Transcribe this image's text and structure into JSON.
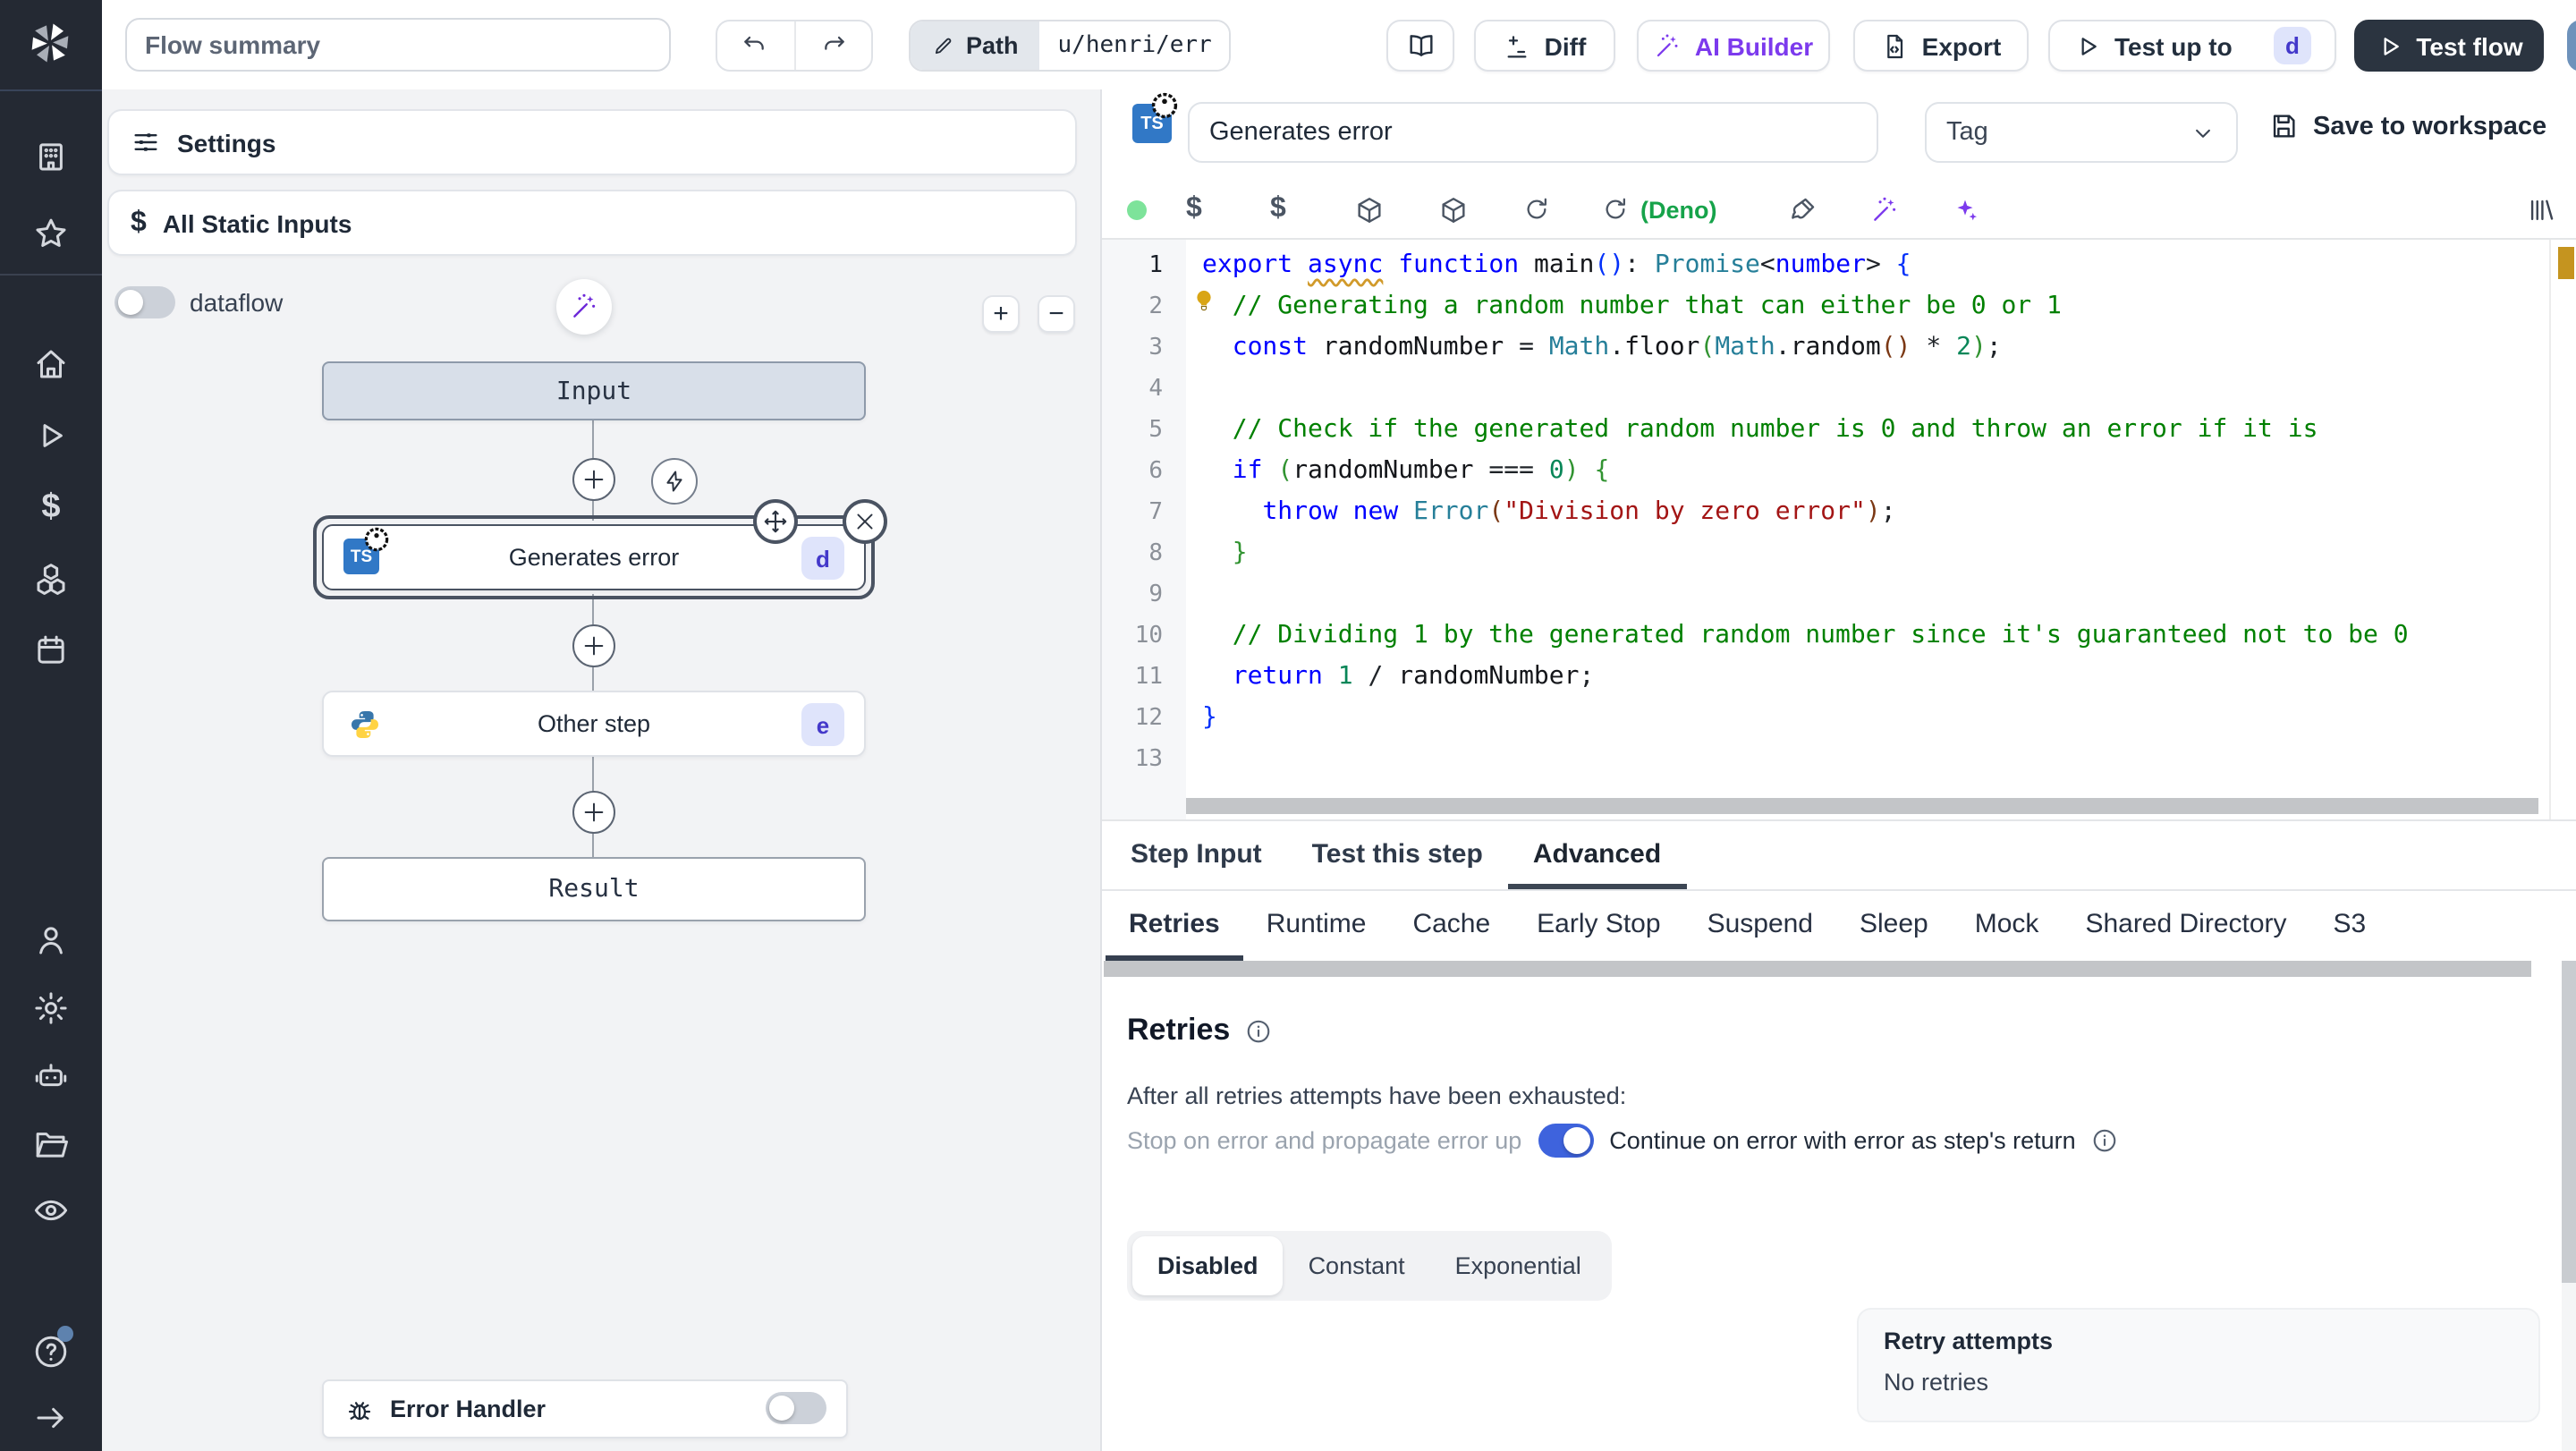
{
  "colors": {
    "accent_blue": "#3e63dd",
    "purple": "#7c3aed",
    "deno_green": "#16a34a",
    "badge_bg": "#dfe4fb",
    "badge_text": "#4338ca",
    "dark_button": "#2b3440",
    "warning_marker": "#c5941f",
    "sidebar_bg": "#242933"
  },
  "topbar": {
    "flow_summary": "Flow summary",
    "path_label": "Path",
    "path_value": "u/henri/err",
    "diff": "Diff",
    "ai_builder": "AI Builder",
    "export": "Export",
    "test_up_to": "Test up to",
    "test_up_to_badge": "d",
    "test_flow": "Test flow"
  },
  "graph": {
    "settings": "Settings",
    "all_static_inputs": "All Static Inputs",
    "dataflow": "dataflow",
    "zoom_in": "+",
    "zoom_out": "−",
    "input_node": "Input",
    "result_node": "Result",
    "error_handler": "Error Handler",
    "steps": [
      {
        "title": "Generates error",
        "badge": "d",
        "language": "typescript",
        "icon_label": "TS"
      },
      {
        "title": "Other step",
        "badge": "e",
        "language": "python"
      }
    ]
  },
  "step_editor": {
    "name": "Generates error",
    "icon_label": "TS",
    "tag_placeholder": "Tag",
    "save": "Save to workspace",
    "runtime": "(Deno)"
  },
  "code": {
    "bulb_line": 2,
    "lines": [
      [
        [
          "kw",
          "export"
        ],
        [
          "pl",
          " "
        ],
        [
          "kw sq",
          "async"
        ],
        [
          "pl",
          " "
        ],
        [
          "kw",
          "function"
        ],
        [
          "pl",
          " "
        ],
        [
          "id",
          "main"
        ],
        [
          "br1",
          "("
        ],
        [
          "br1",
          ")"
        ],
        [
          "pl",
          ": "
        ],
        [
          "type",
          "Promise"
        ],
        [
          "pl",
          "<"
        ],
        [
          "kw",
          "number"
        ],
        [
          "pl",
          "> "
        ],
        [
          "br1",
          "{"
        ]
      ],
      [
        [
          "pl",
          "  "
        ],
        [
          "cm",
          "// Generating a random number that can either be 0 or 1"
        ]
      ],
      [
        [
          "pl",
          "  "
        ],
        [
          "kw",
          "const"
        ],
        [
          "pl",
          " "
        ],
        [
          "id",
          "randomNumber"
        ],
        [
          "pl",
          " = "
        ],
        [
          "type",
          "Math"
        ],
        [
          "pl",
          "."
        ],
        [
          "id",
          "floor"
        ],
        [
          "br2",
          "("
        ],
        [
          "type",
          "Math"
        ],
        [
          "pl",
          "."
        ],
        [
          "id",
          "random"
        ],
        [
          "br3",
          "("
        ],
        [
          "br3",
          ")"
        ],
        [
          "pl",
          " * "
        ],
        [
          "num",
          "2"
        ],
        [
          "br2",
          ")"
        ],
        [
          "pl",
          ";"
        ]
      ],
      [],
      [
        [
          "pl",
          "  "
        ],
        [
          "cm",
          "// Check if the generated random number is 0 and throw an error if it is"
        ]
      ],
      [
        [
          "pl",
          "  "
        ],
        [
          "kw",
          "if"
        ],
        [
          "pl",
          " "
        ],
        [
          "br2",
          "("
        ],
        [
          "id",
          "randomNumber"
        ],
        [
          "pl",
          " === "
        ],
        [
          "num",
          "0"
        ],
        [
          "br2",
          ")"
        ],
        [
          "pl",
          " "
        ],
        [
          "br2",
          "{"
        ]
      ],
      [
        [
          "pl",
          "    "
        ],
        [
          "kw",
          "throw"
        ],
        [
          "pl",
          " "
        ],
        [
          "kw",
          "new"
        ],
        [
          "pl",
          " "
        ],
        [
          "type",
          "Error"
        ],
        [
          "br3",
          "("
        ],
        [
          "str",
          "\"Division by zero error\""
        ],
        [
          "br3",
          ")"
        ],
        [
          "pl",
          ";"
        ]
      ],
      [
        [
          "pl",
          "  "
        ],
        [
          "br2",
          "}"
        ]
      ],
      [],
      [
        [
          "pl",
          "  "
        ],
        [
          "cm",
          "// Dividing 1 by the generated random number since it's guaranteed not to be 0"
        ]
      ],
      [
        [
          "pl",
          "  "
        ],
        [
          "kw",
          "return"
        ],
        [
          "pl",
          " "
        ],
        [
          "num",
          "1"
        ],
        [
          "pl",
          " / "
        ],
        [
          "id",
          "randomNumber"
        ],
        [
          "pl",
          ";"
        ]
      ],
      [
        [
          "br1",
          "}"
        ]
      ],
      []
    ]
  },
  "tabs": {
    "items": [
      "Step Input",
      "Test this step",
      "Advanced"
    ],
    "active": "Advanced"
  },
  "subtabs": {
    "items": [
      "Retries",
      "Runtime",
      "Cache",
      "Early Stop",
      "Suspend",
      "Sleep",
      "Mock",
      "Shared Directory",
      "S3"
    ],
    "active": "Retries"
  },
  "retries": {
    "heading": "Retries",
    "exhausted": "After all retries attempts have been exhausted:",
    "stop_label": "Stop on error and propagate error up",
    "continue_label": "Continue on error with error as step's return",
    "continue_on_error": true,
    "modes": [
      "Disabled",
      "Constant",
      "Exponential"
    ],
    "active_mode": "Disabled",
    "retry_attempts_label": "Retry attempts",
    "retry_attempts_value": "No retries"
  }
}
